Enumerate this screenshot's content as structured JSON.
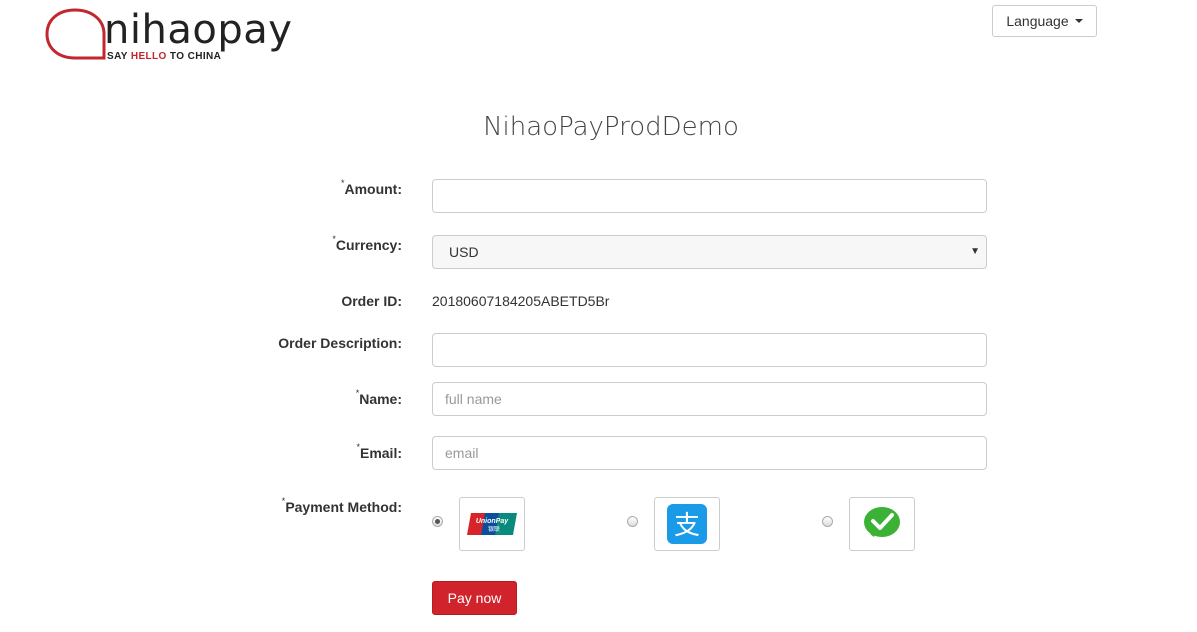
{
  "header": {
    "logo_part1": "nihao",
    "logo_part2": "pay",
    "tagline_pre": "SAY ",
    "tagline_hl": "HELLO",
    "tagline_post": " TO CHINA",
    "language_label": "Language"
  },
  "form": {
    "title": "NihaoPayProdDemo",
    "required_mark": "*",
    "amount_label": "Amount:",
    "amount_value": "",
    "currency_label": "Currency:",
    "currency_value": "USD",
    "currency_arrow": "▼",
    "order_id_label": "Order ID:",
    "order_id_value": "20180607184205ABETD5Br",
    "order_desc_label": "Order Description:",
    "order_desc_value": "",
    "name_label": "Name:",
    "name_placeholder": "full name",
    "email_label": "Email:",
    "email_placeholder": "email",
    "payment_label": "Payment Method:",
    "payment_methods": [
      {
        "name": "unionpay",
        "checked": true,
        "logo_text": "UnionPay",
        "logo_subtext": "银联"
      },
      {
        "name": "alipay",
        "checked": false,
        "logo_text": "支"
      },
      {
        "name": "wechatpay",
        "checked": false
      }
    ],
    "submit_label": "Pay now"
  },
  "colors": {
    "brand_red": "#c1272d",
    "button_red": "#d0232b",
    "alipay_blue": "#1a9be8",
    "wechat_green": "#3bb235"
  }
}
